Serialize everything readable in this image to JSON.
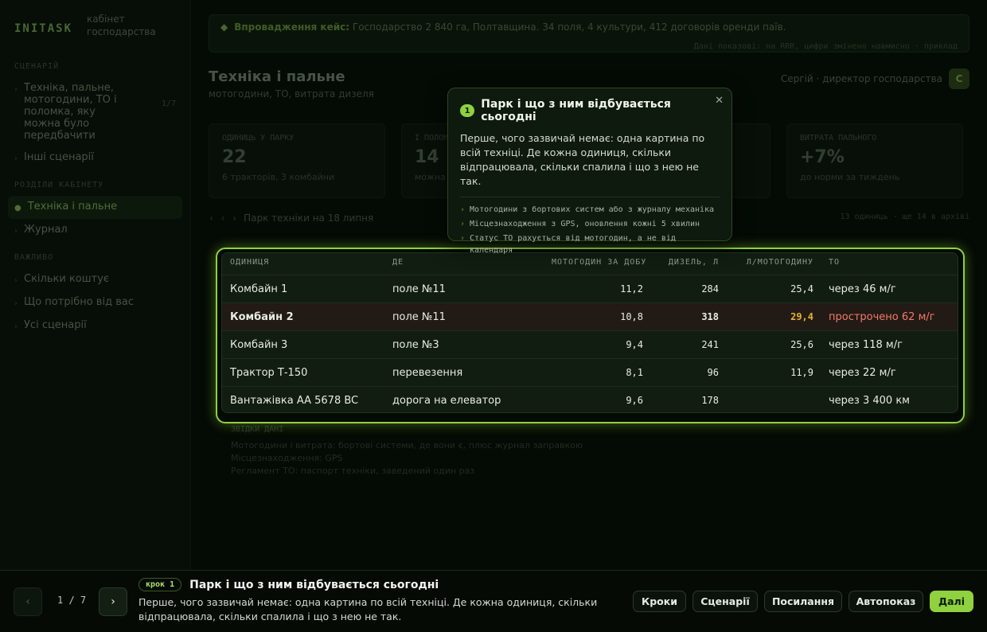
{
  "brand": {
    "logo": "INITASK",
    "subtitle_1": "кабінет",
    "subtitle_2": "господарства"
  },
  "sidebar": {
    "section1": "СЦЕНАРІЙ",
    "scenario_item": "Техніка, пальне, мотогодини, ТО і поломка, яку можна було передбачити",
    "scenario_count": "1/7",
    "other_scenarios": "Інші сценарії",
    "section2": "РОЗДІЛИ КАБІНЕТУ",
    "nav_active": "Техніка і пальне",
    "nav_journal": "Журнал",
    "section3": "ВАЖЛИВО",
    "link_cost": "Скільки коштує",
    "link_need": "Що потрібно від вас",
    "link_all": "Усі сценарії"
  },
  "banner": {
    "label": "Впровадження кейс:",
    "text": "Господарство 2 840 га, Полтавщина. 34 поля, 4 культури, 412 договорів оренди паїв.",
    "sub": "Дані показові: на RRR, цифри змінено навмисно  ·  приклад"
  },
  "page": {
    "title": "Техніка і пальне",
    "subtitle": "мотогодини, ТО, витрата дизеля"
  },
  "user": {
    "name": "Сергій · директор господарства",
    "initial": "С"
  },
  "cards": [
    {
      "label": "ОДИНИЦЬ У ПАРКУ",
      "value": "22",
      "hint": "6 тракторів, 3 комбайни"
    },
    {
      "label": "І ПОЛОМКА",
      "value": "14",
      "hint": "можна"
    },
    {
      "label": "",
      "value": "",
      "hint": ""
    },
    {
      "label": "ВИТРАТА ПАЛЬНОГО",
      "value": "+7%",
      "hint": "до норми за тиждень"
    }
  ],
  "table_head": {
    "nav": "‹ ‹ ›",
    "title": "Парк техніки на 18 липня",
    "right": "13 одиниць · ще 14 в архіві"
  },
  "table": {
    "columns": [
      "ОДИНИЦЯ",
      "ДЕ",
      "МОТОГОДИН ЗА ДОБУ",
      "ДИЗЕЛЬ, Л",
      "Л/МОТОГОДИНУ",
      "ТО"
    ],
    "rows": [
      {
        "unit": "Комбайн 1",
        "where": "поле №11",
        "hours": "11,2",
        "diesel": "284",
        "per_hour": "25,4",
        "service": "через 46 м/г"
      },
      {
        "unit": "Комбайн 2",
        "where": "поле №11",
        "hours": "10,8",
        "diesel": "318",
        "per_hour": "29,4",
        "service": "прострочено 62 м/г"
      },
      {
        "unit": "Комбайн 3",
        "where": "поле №3",
        "hours": "9,4",
        "diesel": "241",
        "per_hour": "25,6",
        "service": "через 118 м/г"
      },
      {
        "unit": "Трактор Т-150",
        "where": "перевезення",
        "hours": "8,1",
        "diesel": "96",
        "per_hour": "11,9",
        "service": "через 22 м/г"
      },
      {
        "unit": "Вантажівка AA 5678 BC",
        "where": "дорога на елеватор",
        "hours": "9,6",
        "diesel": "178",
        "per_hour": "",
        "service": "через 3 400 км"
      }
    ]
  },
  "notes": {
    "label": "ЗВІДКИ ДАНІ",
    "lines": [
      "Мотогодини і витрата: бортові системи, де вони є, плюс журнал заправкою",
      "Місцезнаходження: GPS",
      "Регламент ТО: паспорт техніки, заведений один раз"
    ]
  },
  "popover": {
    "badge": "1",
    "title": "Парк і що з ним відбувається сьогодні",
    "body": "Перше, чого зазвичай немає: одна картина по всій техніці. Де кожна одиниця, скільки відпрацювала, скільки спалила і що з нею не так.",
    "bullets": [
      "Мотогодини з бортових систем або з журналу механіка",
      "Місцезнаходження з GPS, оновлення кожні 5 хвилин",
      "Статус ТО рахується від мотогодин, а не від календаря"
    ]
  },
  "bottom": {
    "counter": "1 / 7",
    "step_tag": "крок 1",
    "step_title": "Парк і що з ним відбувається сьогодні",
    "step_desc": "Перше, чого зазвичай немає: одна картина по всій техніці. Де кожна одиниця, скільки відпрацювала, скільки спалила і що з нею не так.",
    "buttons": {
      "steps": "Кроки",
      "scenarios": "Сценарії",
      "links": "Посилання",
      "autoplay": "Автопоказ",
      "next": "Далі"
    }
  },
  "colors": {
    "accent": "#8fd13f",
    "warning": "#e2b23a",
    "danger": "#f07a6e"
  }
}
